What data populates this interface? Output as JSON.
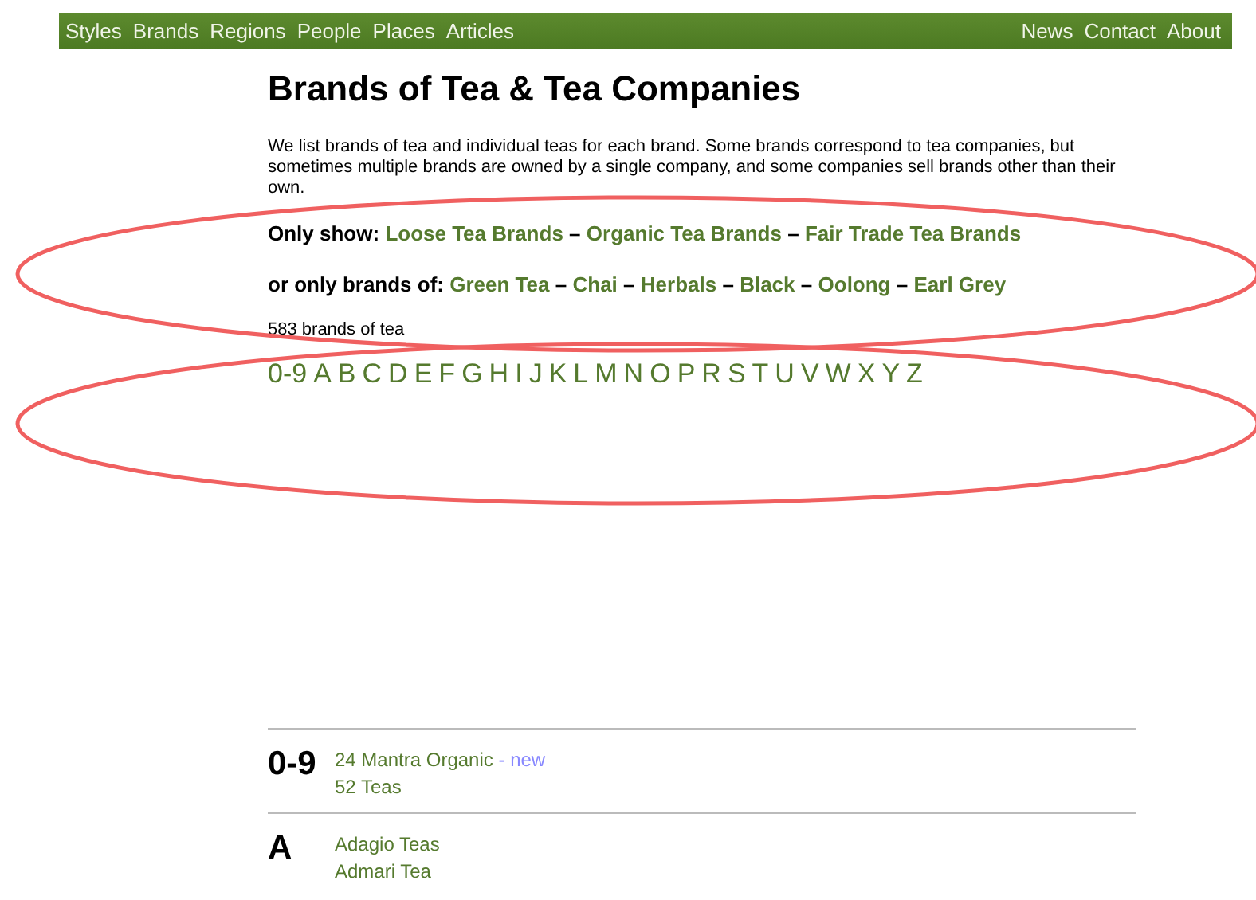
{
  "nav": {
    "left": [
      "Styles",
      "Brands",
      "Regions",
      "People",
      "Places",
      "Articles"
    ],
    "right": [
      "News",
      "Contact",
      "About"
    ]
  },
  "title": "Brands of Tea & Tea Companies",
  "intro": "We list brands of tea and individual teas for each brand. Some brands correspond to tea companies, but sometimes multiple brands are owned by a single company, and some companies sell brands other than their own.",
  "filters": [
    {
      "label": "Only show:",
      "separator": "–",
      "links": [
        "Loose Tea Brands",
        "Organic Tea Brands",
        "Fair Trade Tea Brands"
      ]
    },
    {
      "label": "or only brands of:",
      "separator": "–",
      "links": [
        "Green Tea",
        "Chai",
        "Herbals",
        "Black",
        "Oolong",
        "Earl Grey"
      ]
    }
  ],
  "count": "583 brands of tea",
  "letters": [
    "0-9",
    "A",
    "B",
    "C",
    "D",
    "E",
    "F",
    "G",
    "H",
    "I",
    "J",
    "K",
    "L",
    "M",
    "N",
    "O",
    "P",
    "R",
    "S",
    "T",
    "U",
    "V",
    "W",
    "X",
    "Y",
    "Z"
  ],
  "sections": [
    {
      "letter": "0-9",
      "brands": [
        {
          "name": "24 Mantra Organic",
          "badge": "- new"
        },
        {
          "name": "52 Teas"
        }
      ]
    },
    {
      "letter": "A",
      "brands": [
        {
          "name": "Adagio Teas"
        },
        {
          "name": "Admari Tea"
        }
      ]
    }
  ]
}
